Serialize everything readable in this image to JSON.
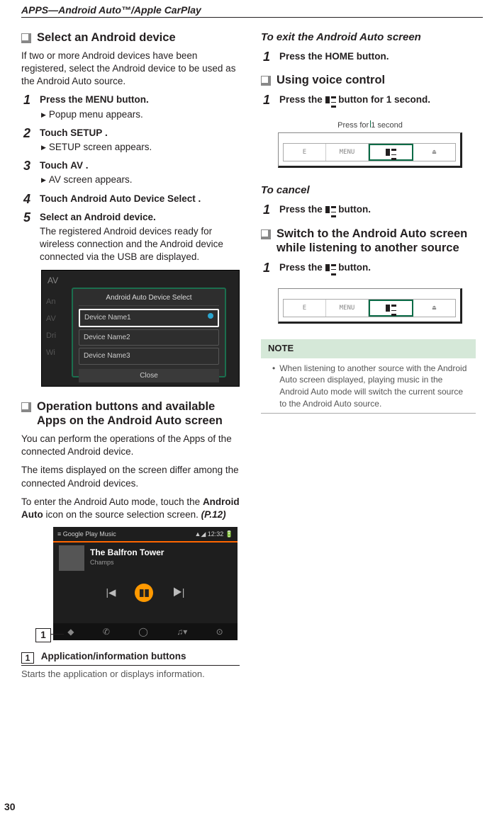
{
  "header": "APPS—Android Auto™/Apple CarPlay",
  "page_no": "30",
  "left": {
    "sec1_title": "Select an Android device",
    "sec1_intro": "If two or more Android devices have been registered, select the Android device to be used as the Android Auto source.",
    "step1": {
      "pre": "Press the ",
      "key": "MENU",
      "post": " button."
    },
    "step1_sub": "Popup menu appears.",
    "step2": {
      "pre": "Touch ",
      "key": "SETUP",
      "post": " ."
    },
    "step2_sub": "SETUP screen appears.",
    "step3": {
      "pre": "Touch ",
      "key": "AV",
      "post": " ."
    },
    "step3_sub": "AV screen appears.",
    "step4": {
      "pre": "Touch ",
      "key": "Android Auto Device Select",
      "post": " ."
    },
    "step5": "Select an Android device.",
    "step5_body": "The registered Android devices ready for wireless connection and the Android device connected via the USB are displayed.",
    "shot": {
      "av": "AV",
      "side1": "An",
      "side2": "AV",
      "side3": "Dri",
      "side4": "Wi",
      "title": "Android Auto Device Select",
      "d1": "Device Name1",
      "d2": "Device Name2",
      "d3": "Device Name3",
      "close": "Close"
    },
    "sec2_title": "Operation buttons and available Apps on the Android Auto screen",
    "sec2_p1": "You can perform the operations of the Apps of the connected Android device.",
    "sec2_p2": "The items displayed on the screen differ among the connected Android devices.",
    "sec2_p3_a": "To enter the Android Auto mode, touch the ",
    "sec2_p3_key": "Android Auto",
    "sec2_p3_b": " icon on the source selection screen. ",
    "sec2_p3_ref": "(P.12)",
    "music": {
      "header": "≡   Google Play Music",
      "time": "▲◢ 12:32    🔋",
      "title": "The Balfron Tower",
      "artist": "Champs"
    },
    "callout": "1",
    "legend_num": "1",
    "legend_title": "Application/information buttons",
    "legend_body": "Starts the application or displays information."
  },
  "right": {
    "subA": "To exit the Android Auto screen",
    "stepA": {
      "pre": "Press the ",
      "key": "HOME",
      "post": " button."
    },
    "secB": "Using voice control",
    "stepB_pre": "Press the ",
    "stepB_post": " button for 1 second.",
    "cap1": "Press for 1 second",
    "hw_menu": "MENU",
    "subC": "To cancel",
    "stepC_pre": "Press the ",
    "stepC_post": " button.",
    "secD": "Switch to the Android Auto screen while listening to another source",
    "stepD_pre": "Press the ",
    "stepD_post": " button.",
    "note_head": "NOTE",
    "note_body": "When listening to another source with the Android Auto screen displayed, playing music in the Android Auto mode will switch the current source to the Android Auto source."
  }
}
